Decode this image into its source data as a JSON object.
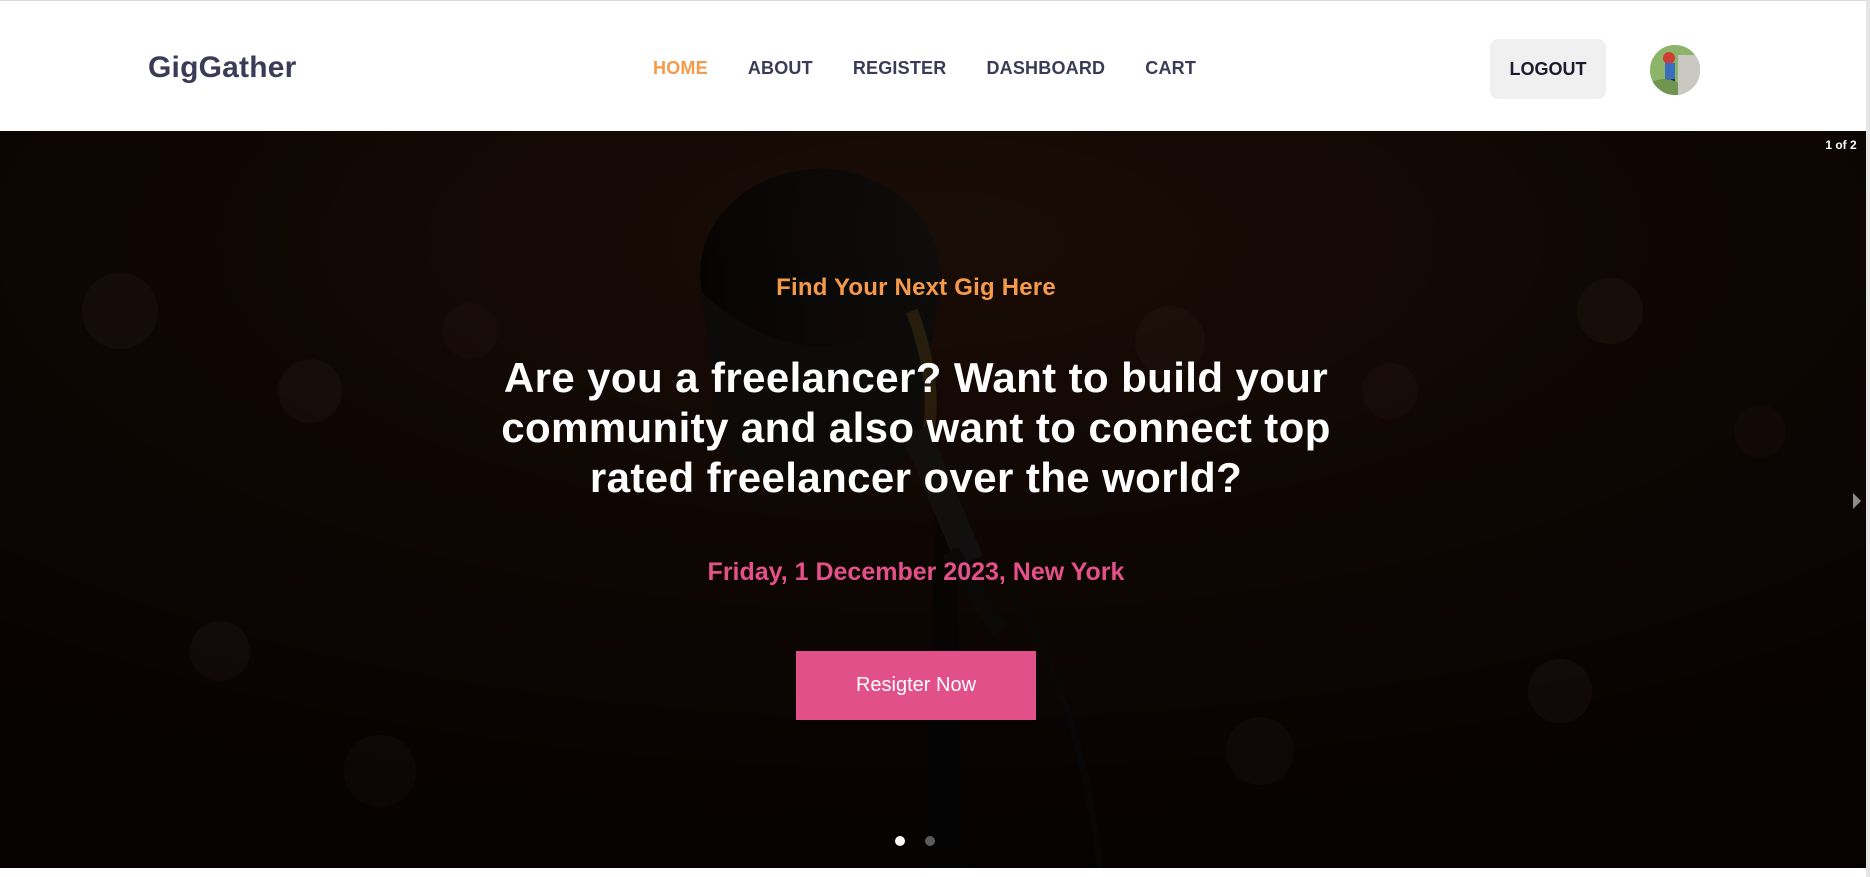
{
  "brand": {
    "name": "GigGather"
  },
  "nav": {
    "items": [
      {
        "label": "HOME",
        "active": true
      },
      {
        "label": "ABOUT",
        "active": false
      },
      {
        "label": "REGISTER",
        "active": false
      },
      {
        "label": "DASHBOARD",
        "active": false
      },
      {
        "label": "CART",
        "active": false
      }
    ],
    "accent_color": "#f49a4a",
    "text_color": "#3a3b57"
  },
  "account": {
    "logout_label": "LOGOUT",
    "avatar_icon": "user-avatar"
  },
  "hero": {
    "eyebrow": "Find Your Next Gig Here",
    "headline": "Are you a freelancer? Want to build your community and also want to connect top rated freelancer over the world?",
    "date_line": "Friday, 1 December 2023, New York",
    "cta_label": "Resigter Now",
    "slide_counter": "1 of 2",
    "active_slide": 1,
    "slide_count": 2,
    "eyebrow_color": "#f49a4a",
    "date_color": "#e4518a",
    "cta_color": "#e2508a",
    "background_description_icon": "microphone-crowd-background"
  }
}
